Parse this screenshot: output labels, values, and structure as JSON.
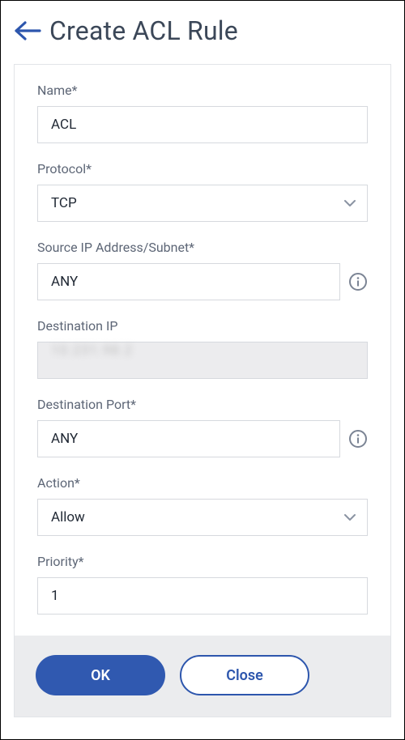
{
  "header": {
    "title": "Create ACL Rule"
  },
  "form": {
    "name": {
      "label": "Name*",
      "value": "ACL"
    },
    "protocol": {
      "label": "Protocol*",
      "value": "TCP"
    },
    "sourceIp": {
      "label": "Source IP Address/Subnet*",
      "value": "ANY"
    },
    "destIp": {
      "label": "Destination IP",
      "value": "10.231.98.2"
    },
    "destPort": {
      "label": "Destination Port*",
      "value": "ANY"
    },
    "action": {
      "label": "Action*",
      "value": "Allow"
    },
    "priority": {
      "label": "Priority*",
      "value": "1"
    }
  },
  "footer": {
    "ok": "OK",
    "close": "Close"
  }
}
